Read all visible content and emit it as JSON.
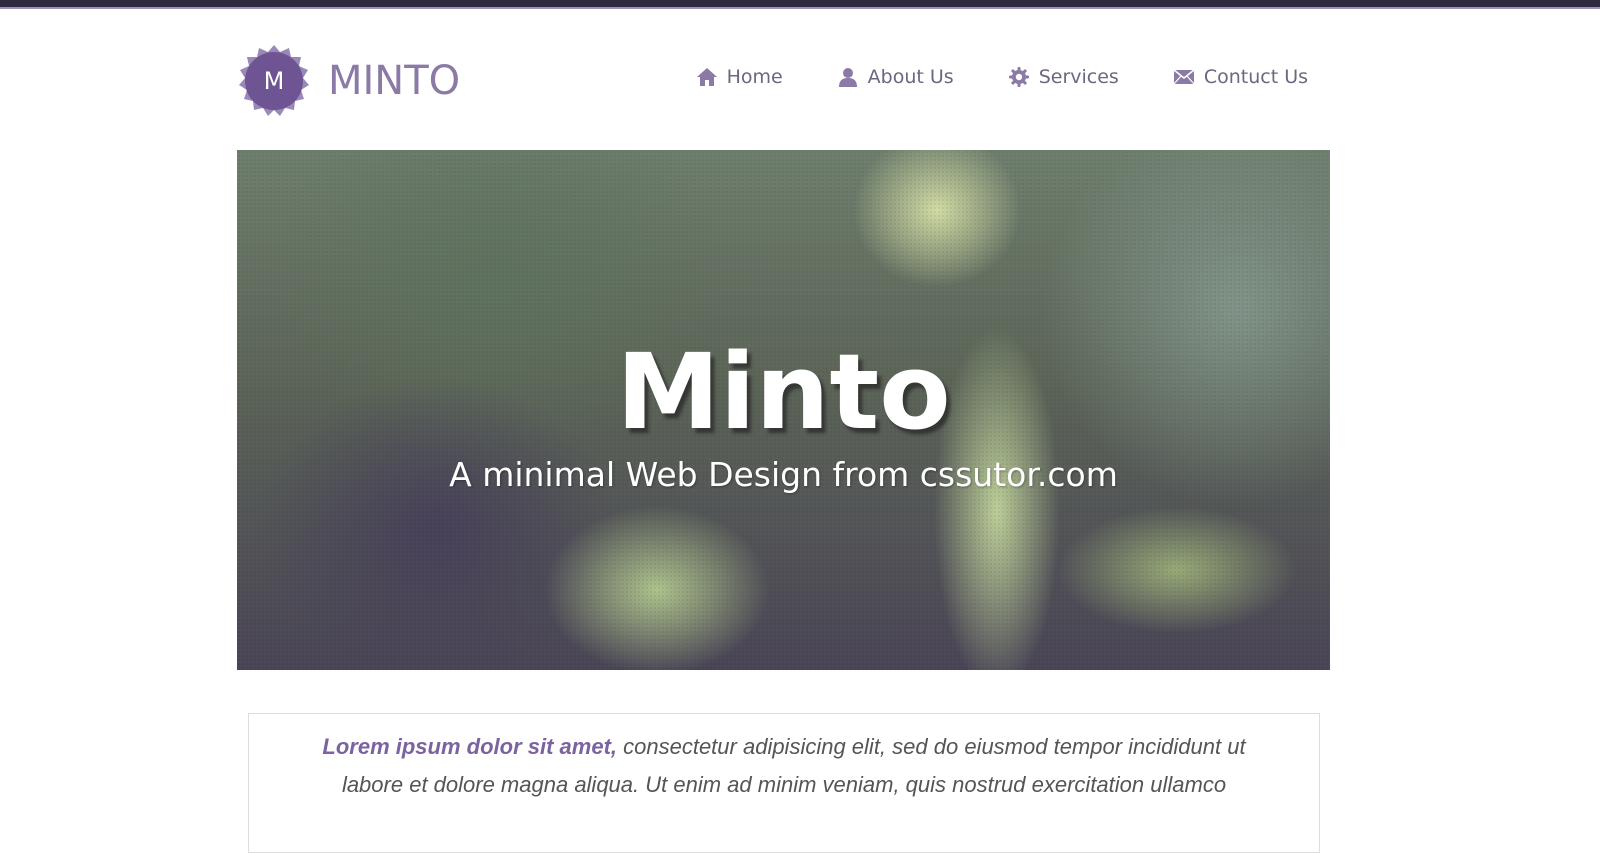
{
  "colors": {
    "accent": "#7a63a0",
    "logo_text": "#8b7aa6",
    "nav_text": "#6f6580",
    "top_bar": "#2f2a3d"
  },
  "logo": {
    "letter": "M",
    "name": "MINTO"
  },
  "nav": {
    "items": [
      {
        "label": "Home",
        "icon": "home-icon"
      },
      {
        "label": "About Us",
        "icon": "user-icon"
      },
      {
        "label": "Services",
        "icon": "gear-icon"
      },
      {
        "label": "Contuct Us",
        "icon": "mail-icon"
      }
    ]
  },
  "hero": {
    "title": "Minto",
    "subtitle": "A minimal Web Design from cssutor.com"
  },
  "intro": {
    "lead": "Lorem ipsum dolor sit amet,",
    "body": " consectetur adipisicing elit, sed do eiusmod tempor incididunt ut labore et dolore magna aliqua. Ut enim ad minim veniam, quis nostrud exercitation ullamco"
  }
}
